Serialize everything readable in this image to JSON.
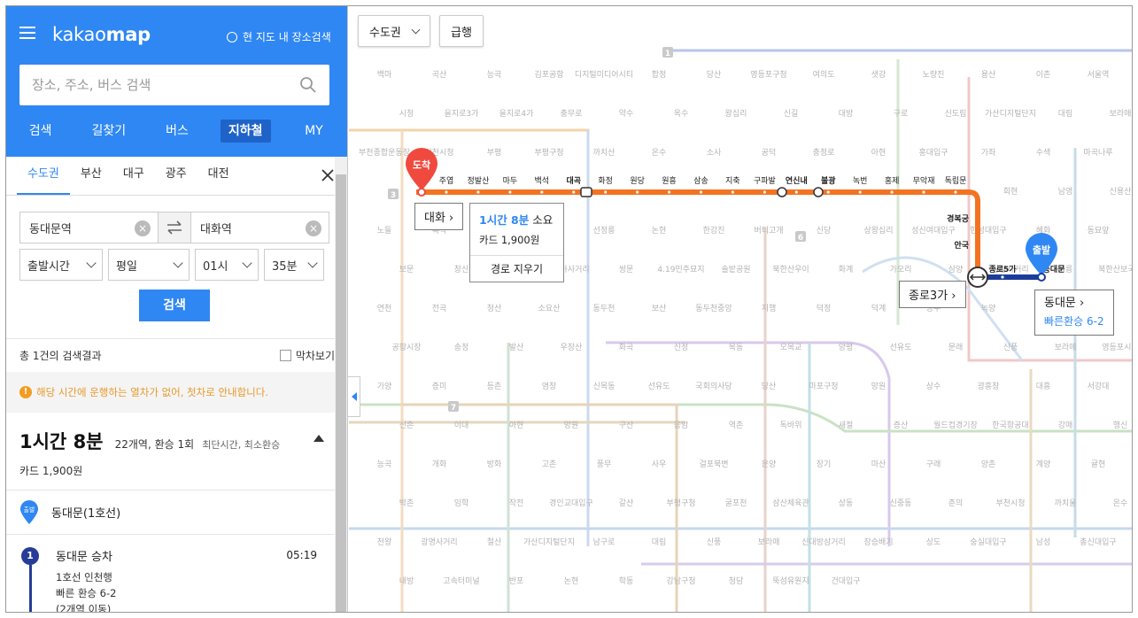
{
  "header": {
    "logo_prefix": "kakao",
    "logo_suffix": "map",
    "area_search_label": "현 지도 내 장소검색"
  },
  "search": {
    "placeholder": "장소, 주소, 버스 검색"
  },
  "nav_tabs": [
    "검색",
    "길찾기",
    "버스",
    "지하철",
    "MY"
  ],
  "region_tabs": [
    "수도권",
    "부산",
    "대구",
    "광주",
    "대전"
  ],
  "route": {
    "from": "동대문역",
    "to": "대화역"
  },
  "selects": {
    "departure_type": "출발시간",
    "day_type": "평일",
    "hour": "01시",
    "minute": "35분"
  },
  "search_button": "검색",
  "result_count": "총 1건의 검색결과",
  "last_train_label": "막차보기",
  "notice": "해당 시간에 운행하는 열차가 없어, 첫차로 안내합니다.",
  "summary": {
    "duration": "1시간 8분",
    "stations_transfers": "22개역, 환승 1회",
    "criteria": "최단시간, 최소환승",
    "fare": "카드 1,900원"
  },
  "start_point": {
    "badge": "출발",
    "label": "동대문(1호선)"
  },
  "step": {
    "number": "1",
    "title": "동대문 승차",
    "time": "05:19",
    "line": "1호선 인천행",
    "transfer": "빠른 환승 6-2",
    "next": "(2개역 이동)"
  },
  "map": {
    "region_select": "수도권",
    "express_button": "급행",
    "arrival_badge": "도착",
    "departure_badge": "출발",
    "dest_label": "대화",
    "origin_label": "동대문",
    "origin_transfer": "빠른환승 6-2",
    "transfer_label": "종로3가",
    "callout_duration": "1시간 8분",
    "callout_suffix": "소요",
    "callout_fare": "카드 1,900원",
    "callout_clear": "경로 지우기",
    "line3_stations": [
      "주엽",
      "정발산",
      "마두",
      "백석",
      "대곡",
      "화정",
      "원당",
      "원흥",
      "삼송",
      "지축",
      "구파발",
      "연신내",
      "불광",
      "녹번",
      "홍제",
      "무악재",
      "독립문"
    ],
    "line3_east_stations": [
      "경복궁",
      "안국",
      "종로3가"
    ],
    "line1_stations": [
      "종로5가",
      "동대문"
    ],
    "other_stations": [
      "백마",
      "곡산",
      "능곡",
      "김포공항",
      "디지털미디어시티",
      "합정",
      "당산",
      "영등포구청",
      "여의도",
      "샛강",
      "노량진",
      "용산",
      "이촌",
      "서울역",
      "시청",
      "을지로3가",
      "을지로4가",
      "충무로",
      "약수",
      "옥수",
      "왕십리",
      "신길",
      "대방",
      "구로",
      "신도림",
      "가산디지털단지",
      "대림",
      "보라매",
      "부천종합운동장",
      "인천시청",
      "부평",
      "부평구청",
      "까치산",
      "온수",
      "소사",
      "공덕",
      "충정로",
      "아현",
      "홍대입구",
      "가좌",
      "수색",
      "마곡나루",
      "청구",
      "동대문역사문화공원",
      "삼각지",
      "숙대입구",
      "효창공원앞",
      "애오개",
      "서대문",
      "광화문",
      "종각",
      "을지로입구",
      "명동",
      "회현",
      "남영",
      "신용산",
      "노들",
      "흑석",
      "동작",
      "구반포",
      "선정릉",
      "논현",
      "한강진",
      "버티고개",
      "신당",
      "상왕십리",
      "성신여대입구",
      "한성대입구",
      "혜화",
      "동묘앞",
      "보문",
      "창신",
      "고려대",
      "미아사거리",
      "쌍문",
      "4.19민주묘지",
      "솔밭공원",
      "북한산우이",
      "화계",
      "가오리",
      "삼양",
      "삼양사거리",
      "정릉",
      "북한산보국문",
      "연천",
      "전곡",
      "청산",
      "소요산",
      "동두천",
      "보산",
      "동두천중앙",
      "지행",
      "덕정",
      "덕계",
      "양주",
      "녹양",
      "마곡",
      "신방화",
      "공항시장",
      "송정",
      "발산",
      "우장산",
      "화곡",
      "신정",
      "목동",
      "오목교",
      "양평",
      "선유도",
      "문래",
      "신풍",
      "보라매",
      "영등포시장",
      "가양",
      "증미",
      "등촌",
      "염창",
      "신목동",
      "선유도",
      "국회의사당",
      "당산",
      "마포구청",
      "망원",
      "상수",
      "광흥창",
      "대흥",
      "서강대",
      "신촌",
      "이대",
      "아현",
      "망원",
      "구산",
      "응암",
      "역촌",
      "독바위",
      "새절",
      "증산",
      "월드컵경기장",
      "한국항공대",
      "강매",
      "행신",
      "능곡",
      "개화",
      "방화",
      "고촌",
      "풍무",
      "사우",
      "걸포북변",
      "운양",
      "장기",
      "마산",
      "구래",
      "양촌",
      "계양",
      "귤현",
      "박촌",
      "임학",
      "작전",
      "경인교대입구",
      "갈산",
      "부평구청",
      "굴포천",
      "삼산체육관",
      "상동",
      "신중동",
      "춘의",
      "부천시청",
      "까치울",
      "온수",
      "천왕",
      "광명사거리",
      "철산",
      "가산디지털단지",
      "남구로",
      "대림",
      "신풍",
      "보라매",
      "신대방삼거리",
      "장승배기",
      "상도",
      "숭실대입구",
      "남성",
      "총신대입구",
      "내방",
      "고속터미널",
      "반포",
      "논현",
      "학동",
      "강남구청",
      "청담",
      "뚝섬유원지",
      "건대입구"
    ],
    "line_numbers": [
      "1",
      "3",
      "6",
      "7"
    ]
  }
}
